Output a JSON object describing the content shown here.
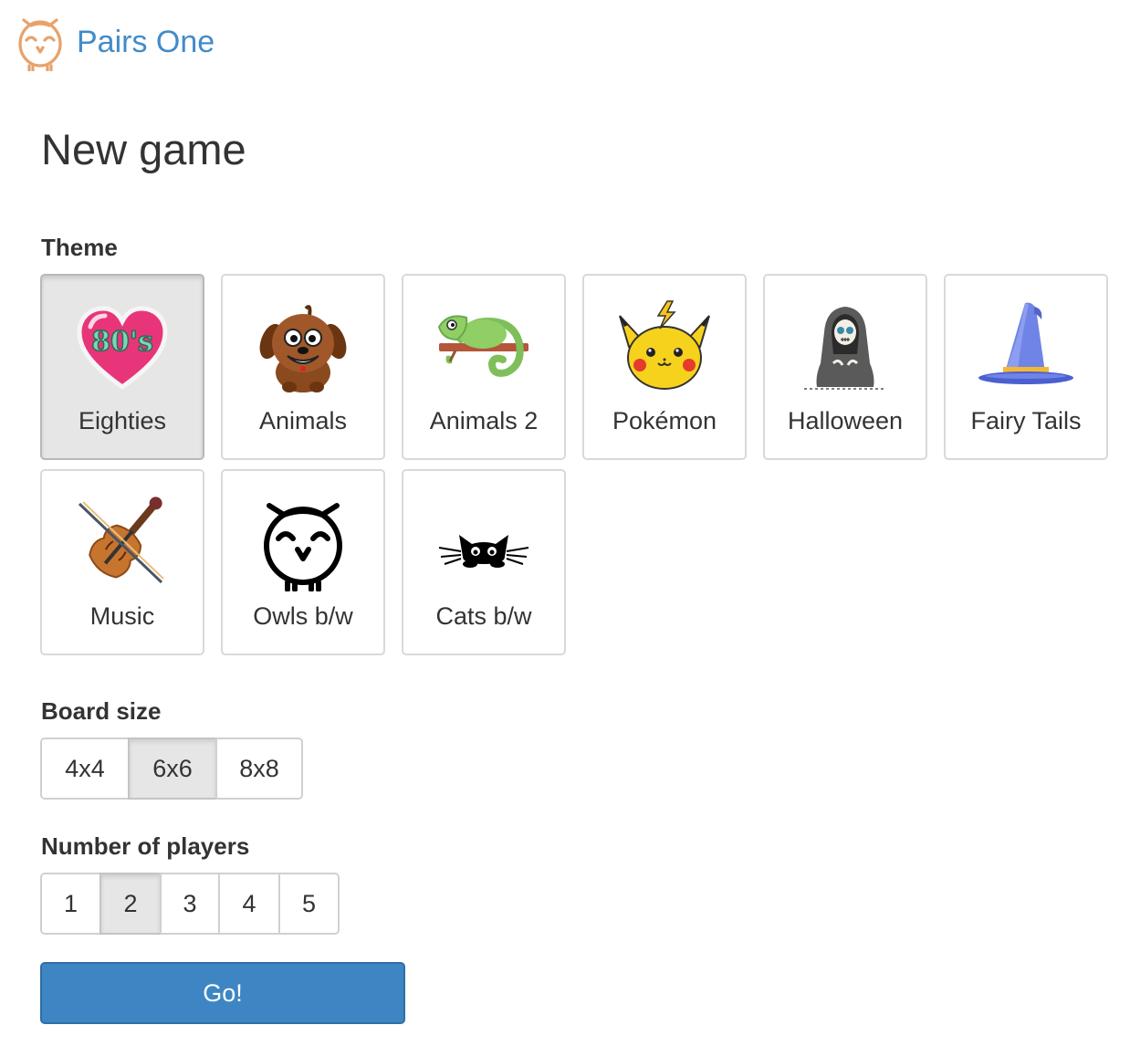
{
  "app": {
    "name": "Pairs One",
    "logo_icon": "owl-logo-icon"
  },
  "page": {
    "title": "New game"
  },
  "theme_section": {
    "label": "Theme",
    "selected": "Eighties",
    "themes": [
      {
        "label": "Eighties",
        "icon": "heart-80s-icon"
      },
      {
        "label": "Animals",
        "icon": "dog-icon"
      },
      {
        "label": "Animals 2",
        "icon": "chameleon-icon"
      },
      {
        "label": "Pokémon",
        "icon": "pikachu-icon"
      },
      {
        "label": "Halloween",
        "icon": "reaper-icon"
      },
      {
        "label": "Fairy Tails",
        "icon": "wizard-hat-icon"
      },
      {
        "label": "Music",
        "icon": "violin-icon"
      },
      {
        "label": "Owls b/w",
        "icon": "owl-bw-icon"
      },
      {
        "label": "Cats b/w",
        "icon": "cat-bw-icon"
      }
    ]
  },
  "board_size": {
    "label": "Board size",
    "options": [
      "4x4",
      "6x6",
      "8x8"
    ],
    "selected": "6x6"
  },
  "players": {
    "label": "Number of players",
    "options": [
      "1",
      "2",
      "3",
      "4",
      "5"
    ],
    "selected": "2"
  },
  "go_button": {
    "label": "Go!"
  },
  "colors": {
    "brand_blue": "#428bca",
    "button_blue": "#3d86c3",
    "selected_gray": "#e6e6e6",
    "logo_orange": "#e8a26a"
  },
  "heart_text": "80's"
}
